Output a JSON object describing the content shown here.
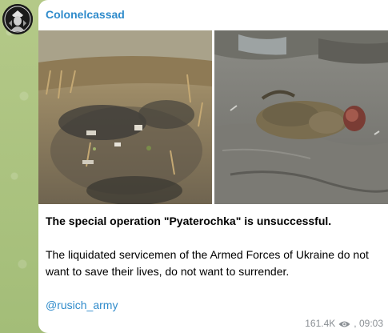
{
  "post": {
    "channel_name": "Colonelcassad",
    "headline": "The special operation \"Pyaterochka\" is unsuccessful.",
    "body": "The liquidated servicemen of the Armed Forces of Ukraine do not want to save their lives, do not want to surrender.",
    "link": "@rusich_army",
    "views": "161.4K",
    "time": ", 09:03"
  },
  "icons": {
    "views": "eye-icon",
    "avatar": "channel-avatar"
  },
  "colors": {
    "accent": "#2f8bcb",
    "chat_background": "#a9c27f",
    "meta": "#8a8f94"
  }
}
